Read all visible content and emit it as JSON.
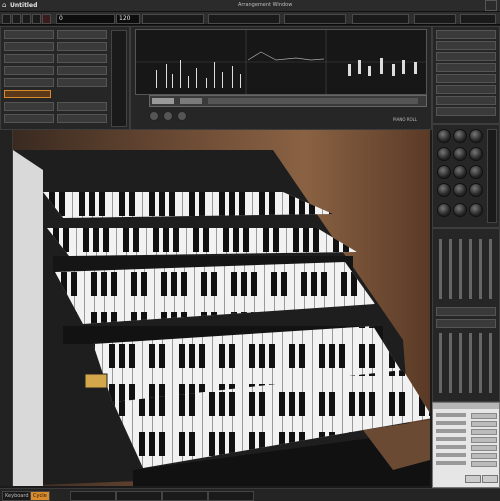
{
  "app": {
    "menu_title": "Untitled",
    "window_title": "Arrangement Window"
  },
  "toolbar": {
    "counter": "0",
    "tempo": "120"
  },
  "editor": {
    "panel_label": "PIANO ROLL"
  },
  "statusbar": {
    "left_label": "Keyboard",
    "mode_label": "Cycle"
  },
  "colors": {
    "accent": "#d98b2b",
    "panel": "#262626",
    "bg": "#1b1b1b"
  }
}
